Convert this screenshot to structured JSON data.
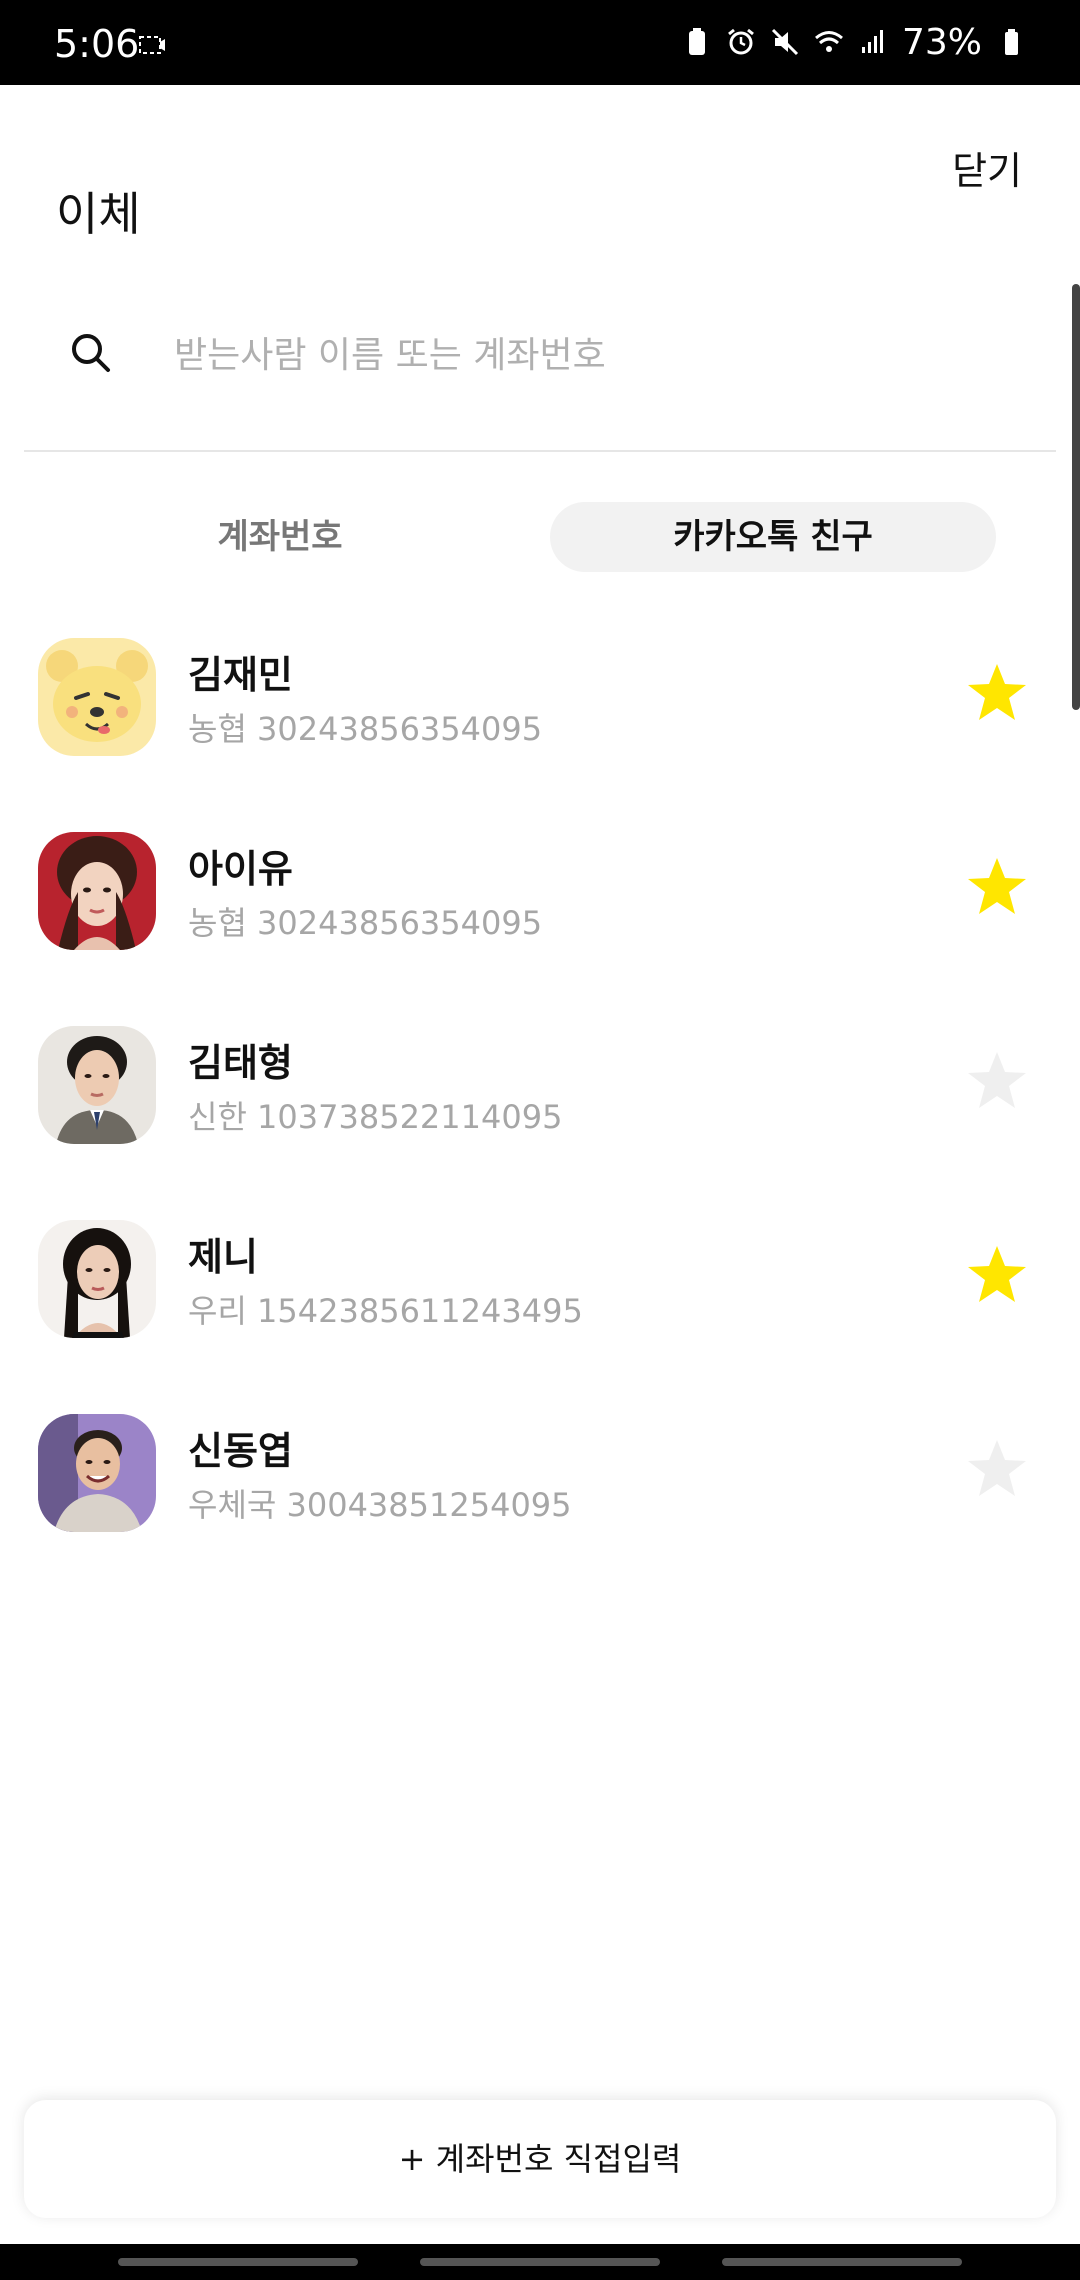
{
  "status_bar": {
    "time": "5:06",
    "battery": "73%"
  },
  "header": {
    "title": "이체",
    "close_label": "닫기"
  },
  "search": {
    "placeholder": "받는사람 이름 또는 계좌번호",
    "value": ""
  },
  "tabs": [
    {
      "label": "계좌번호",
      "selected": false
    },
    {
      "label": "카카오톡 친구",
      "selected": true
    }
  ],
  "contacts": [
    {
      "name": "김재민",
      "account": "농협 30243856354095",
      "favorite": true
    },
    {
      "name": "아이유",
      "account": "농협 30243856354095",
      "favorite": true
    },
    {
      "name": "김태형",
      "account": "신한 103738522114095",
      "favorite": false
    },
    {
      "name": "제니",
      "account": "우리 1542385611243495",
      "favorite": true
    },
    {
      "name": "신동엽",
      "account": "우체국 30043851254095",
      "favorite": false
    }
  ],
  "footer": {
    "manual_entry_label": "+ 계좌번호 직접입력"
  },
  "colors": {
    "star_active": "#FFE600",
    "star_inactive": "#EFEFEF",
    "tab_selected_bg": "#F2F2F2"
  }
}
